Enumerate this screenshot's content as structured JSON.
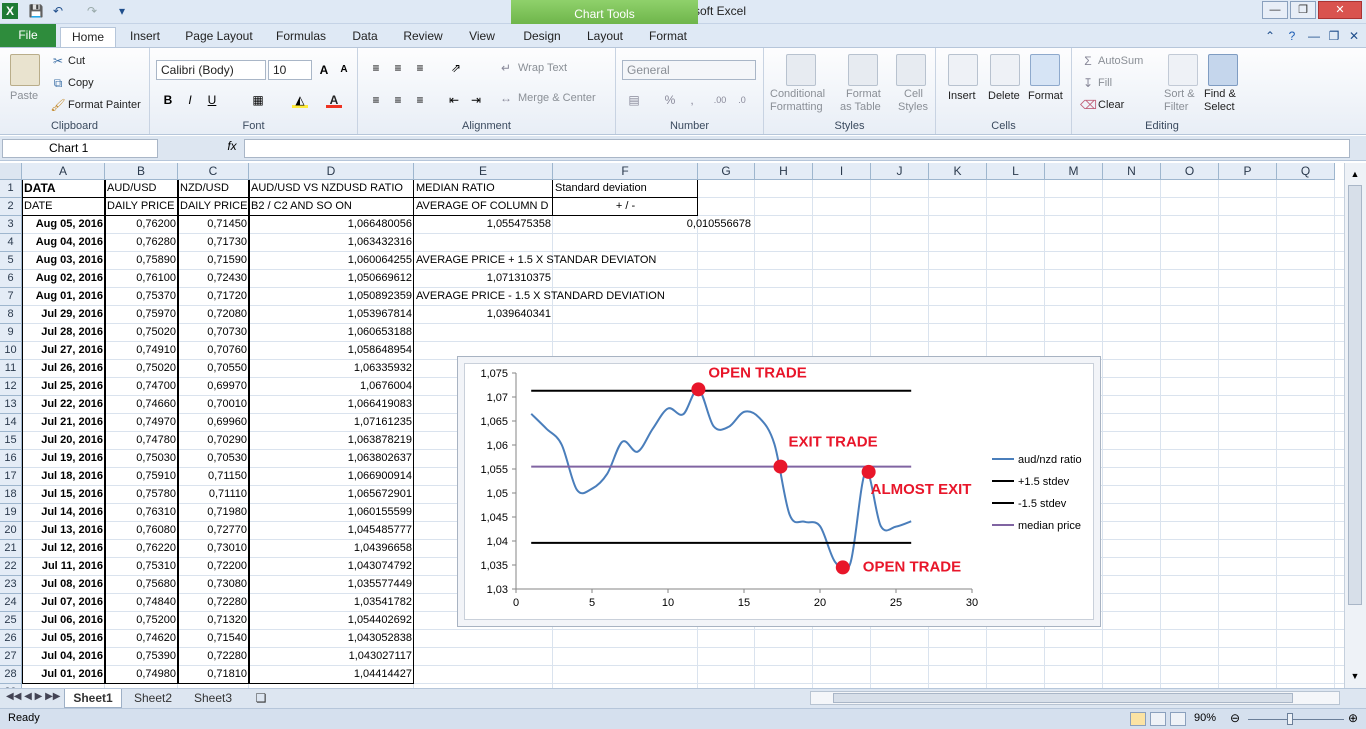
{
  "window": {
    "title": "Book1  -  Microsoft Excel",
    "context_tab_group": "Chart Tools",
    "controls": [
      "minimize-icon",
      "restore-icon",
      "close-icon"
    ]
  },
  "tabs": [
    "Home",
    "Insert",
    "Page Layout",
    "Formulas",
    "Data",
    "Review",
    "View",
    "Design",
    "Layout",
    "Format"
  ],
  "file_tab": "File",
  "active_tab": "Home",
  "ribbon": {
    "clipboard": {
      "label": "Clipboard",
      "paste": "Paste",
      "cut": "Cut",
      "copy": "Copy",
      "format_painter": "Format Painter"
    },
    "font": {
      "label": "Font",
      "font_name": "Calibri (Body)",
      "font_size": "10",
      "bold": "B",
      "italic": "I",
      "underline": "U"
    },
    "alignment": {
      "label": "Alignment",
      "wrap_text": "Wrap Text",
      "merge_center": "Merge & Center"
    },
    "number": {
      "label": "Number",
      "format": "General",
      "percent": "%",
      "comma": ","
    },
    "styles": {
      "label": "Styles",
      "conditional_1": "Conditional",
      "conditional_2": "Formatting",
      "format_table_1": "Format",
      "format_table_2": "as Table",
      "cell_styles_1": "Cell",
      "cell_styles_2": "Styles"
    },
    "cells": {
      "label": "Cells",
      "insert": "Insert",
      "delete": "Delete",
      "format": "Format"
    },
    "editing": {
      "label": "Editing",
      "autosum": "AutoSum",
      "fill": "Fill",
      "clear": "Clear",
      "sort_1": "Sort &",
      "sort_2": "Filter",
      "find_1": "Find &",
      "find_2": "Select"
    }
  },
  "formula_bar": {
    "name_box": "Chart 1",
    "fx": "fx",
    "formula": ""
  },
  "columns": [
    "A",
    "B",
    "C",
    "D",
    "E",
    "F",
    "G",
    "H",
    "I",
    "J",
    "K",
    "L",
    "M",
    "N",
    "O",
    "P",
    "Q"
  ],
  "rows": [
    [
      "DATA",
      "AUD/USD",
      "NZD/USD",
      "AUD/USD VS NZDUSD RATIO",
      "MEDIAN RATIO",
      "Standard deviation"
    ],
    [
      "DATE",
      "DAILY PRICE",
      "DAILY PRICE",
      "B2 / C2 AND SO ON",
      "AVERAGE OF COLUMN D",
      "+ / -"
    ],
    [
      "Aug 05, 2016",
      "0,76200",
      "0,71450",
      "1,066480056",
      "1,055475358",
      "0,010556678"
    ],
    [
      "Aug 04, 2016",
      "0,76280",
      "0,71730",
      "1,063432316",
      "",
      ""
    ],
    [
      "Aug 03, 2016",
      "0,75890",
      "0,71590",
      "1,060064255",
      "AVERAGE PRICE + 1.5 X STANDAR DEVIATON",
      ""
    ],
    [
      "Aug 02, 2016",
      "0,76100",
      "0,72430",
      "1,050669612",
      "1,071310375",
      ""
    ],
    [
      "Aug 01, 2016",
      "0,75370",
      "0,71720",
      "1,050892359",
      "AVERAGE PRICE - 1.5 X STANDARD DEVIATION",
      ""
    ],
    [
      "Jul 29, 2016",
      "0,75970",
      "0,72080",
      "1,053967814",
      "1,039640341",
      ""
    ],
    [
      "Jul 28, 2016",
      "0,75020",
      "0,70730",
      "1,060653188",
      "",
      ""
    ],
    [
      "Jul 27, 2016",
      "0,74910",
      "0,70760",
      "1,058648954",
      "",
      ""
    ],
    [
      "Jul 26, 2016",
      "0,75020",
      "0,70550",
      "1,06335932",
      "",
      ""
    ],
    [
      "Jul 25, 2016",
      "0,74700",
      "0,69970",
      "1,0676004",
      "",
      ""
    ],
    [
      "Jul 22, 2016",
      "0,74660",
      "0,70010",
      "1,066419083",
      "",
      ""
    ],
    [
      "Jul 21, 2016",
      "0,74970",
      "0,69960",
      "1,07161235",
      "",
      ""
    ],
    [
      "Jul 20, 2016",
      "0,74780",
      "0,70290",
      "1,063878219",
      "",
      ""
    ],
    [
      "Jul 19, 2016",
      "0,75030",
      "0,70530",
      "1,063802637",
      "",
      ""
    ],
    [
      "Jul 18, 2016",
      "0,75910",
      "0,71150",
      "1,066900914",
      "",
      ""
    ],
    [
      "Jul 15, 2016",
      "0,75780",
      "0,71110",
      "1,065672901",
      "",
      ""
    ],
    [
      "Jul 14, 2016",
      "0,76310",
      "0,71980",
      "1,060155599",
      "",
      ""
    ],
    [
      "Jul 13, 2016",
      "0,76080",
      "0,72770",
      "1,045485777",
      "",
      ""
    ],
    [
      "Jul 12, 2016",
      "0,76220",
      "0,73010",
      "1,04396658",
      "",
      ""
    ],
    [
      "Jul 11, 2016",
      "0,75310",
      "0,72200",
      "1,043074792",
      "",
      ""
    ],
    [
      "Jul 08, 2016",
      "0,75680",
      "0,73080",
      "1,035577449",
      "",
      ""
    ],
    [
      "Jul 07, 2016",
      "0,74840",
      "0,72280",
      "1,03541782",
      "",
      ""
    ],
    [
      "Jul 06, 2016",
      "0,75200",
      "0,71320",
      "1,054402692",
      "",
      ""
    ],
    [
      "Jul 05, 2016",
      "0,74620",
      "0,71540",
      "1,043052838",
      "",
      ""
    ],
    [
      "Jul 04, 2016",
      "0,75390",
      "0,72280",
      "1,043027117",
      "",
      ""
    ],
    [
      "Jul 01, 2016",
      "0,74980",
      "0,71810",
      "1,04414427",
      "",
      ""
    ]
  ],
  "chart_data": {
    "type": "line",
    "xlim": [
      0,
      30
    ],
    "ylim": [
      1.03,
      1.075
    ],
    "x_ticks": [
      "0",
      "5",
      "10",
      "15",
      "20",
      "25",
      "30"
    ],
    "y_ticks": [
      "1,03",
      "1,035",
      "1,04",
      "1,045",
      "1,05",
      "1,055",
      "1,06",
      "1,065",
      "1,07",
      "1,075"
    ],
    "x": [
      1,
      2,
      3,
      4,
      5,
      6,
      7,
      8,
      9,
      10,
      11,
      12,
      13,
      14,
      15,
      16,
      17,
      18,
      19,
      20,
      21,
      22,
      23,
      24,
      25,
      26
    ],
    "series": [
      {
        "name": "aud/nzd ratio",
        "color": "#4a7ebb",
        "values": [
          1.0665,
          1.0634,
          1.0601,
          1.0507,
          1.0509,
          1.054,
          1.0607,
          1.0586,
          1.0634,
          1.0676,
          1.0664,
          1.0716,
          1.0639,
          1.0638,
          1.0669,
          1.0657,
          1.0602,
          1.0455,
          1.044,
          1.0431,
          1.0356,
          1.0354,
          1.0544,
          1.0431,
          1.043,
          1.0441
        ]
      },
      {
        "name": "+1.5 stdev",
        "color": "#000000",
        "values": [
          1.0713,
          1.0713
        ],
        "x": [
          1,
          26
        ]
      },
      {
        "name": "-1.5 stdev",
        "color": "#000000",
        "values": [
          1.0396,
          1.0396
        ],
        "x": [
          1,
          26
        ]
      },
      {
        "name": "median price",
        "color": "#8064a2",
        "values": [
          1.0555,
          1.0555
        ],
        "x": [
          1,
          26
        ]
      }
    ],
    "markers": [
      {
        "x": 12,
        "y": 1.0716,
        "label": "OPEN TRADE"
      },
      {
        "x": 17.4,
        "y": 1.0555,
        "label": "EXIT TRADE"
      },
      {
        "x": 23.2,
        "y": 1.0544,
        "label": "ALMOST EXIT"
      },
      {
        "x": 21.5,
        "y": 1.0345,
        "label": "OPEN TRADE"
      }
    ],
    "marker_color": "#e8162a",
    "legend_position": "right",
    "grid": false
  },
  "sheets": [
    "Sheet1",
    "Sheet2",
    "Sheet3"
  ],
  "active_sheet": "Sheet1",
  "status": {
    "ready": "Ready",
    "zoom": "90%"
  }
}
